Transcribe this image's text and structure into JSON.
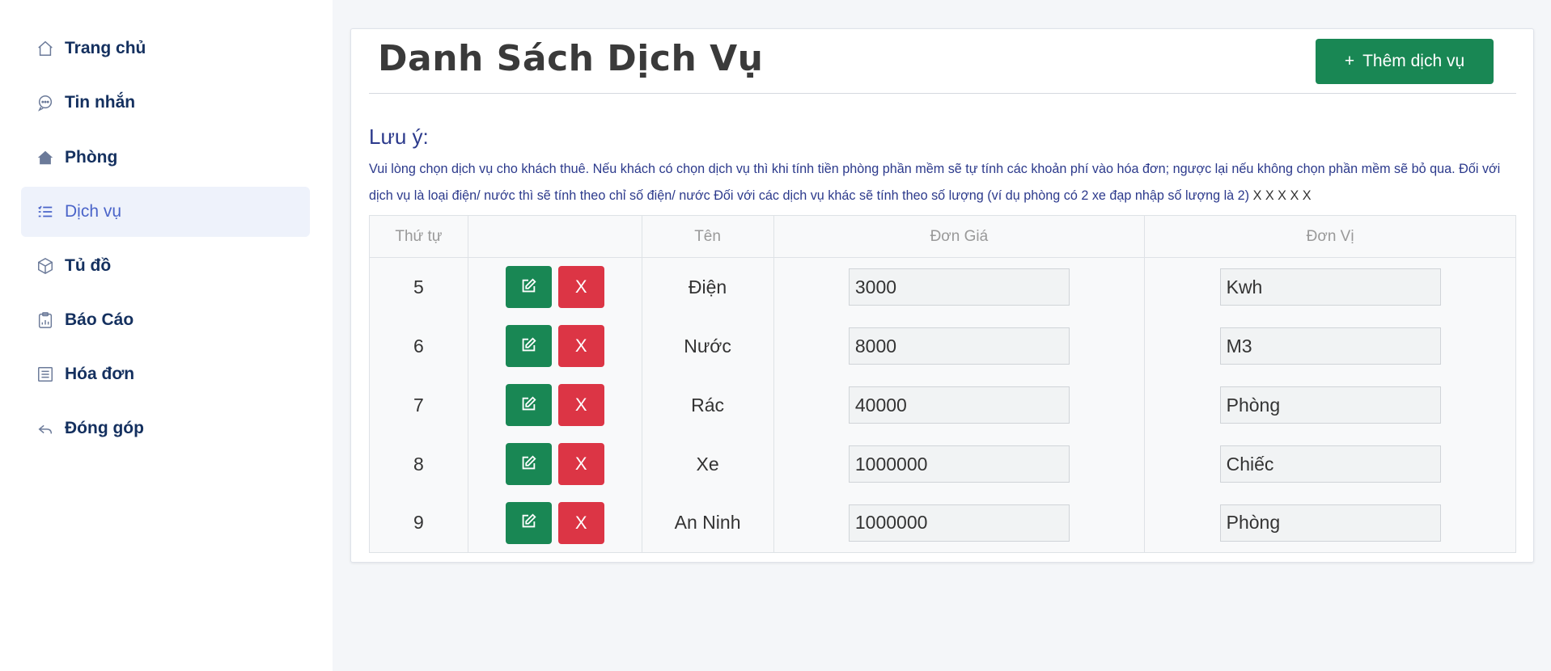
{
  "sidebar": {
    "items": [
      {
        "label": "Trang chủ",
        "icon": "home-icon"
      },
      {
        "label": "Tin nhắn",
        "icon": "chat-icon"
      },
      {
        "label": "Phòng",
        "icon": "house-icon"
      },
      {
        "label": "Dịch vụ",
        "icon": "list-icon",
        "active": true
      },
      {
        "label": "Tủ đồ",
        "icon": "box-icon"
      },
      {
        "label": "Báo Cáo",
        "icon": "clipboard-icon"
      },
      {
        "label": "Hóa đơn",
        "icon": "receipt-icon"
      },
      {
        "label": "Đóng góp",
        "icon": "reply-icon"
      }
    ]
  },
  "main": {
    "title": "Danh Sách Dịch Vụ",
    "add_button": "Thêm dịch vụ",
    "add_button_icon": "+",
    "note_heading": "Lưu ý:",
    "note_text": "Vui lòng chọn dịch vụ cho khách thuê. Nếu khách có chọn dịch vụ thì khi tính tiền phòng phần mềm sẽ tự tính các khoản phí vào hóa đơn; ngược lại nếu không chọn phần mềm sẽ bỏ qua. Đối với dịch vụ là loại điện/ nước thì sẽ tính theo chỉ số điện/ nước Đối với các dịch vụ khác sẽ tính theo số lượng (ví dụ phòng có 2 xe đạp nhập số lượng là 2)",
    "note_suffix": "X X X X X"
  },
  "table": {
    "headers": [
      "Thứ tự",
      "",
      "Tên",
      "Đơn Giá",
      "Đơn Vị"
    ],
    "delete_label": "X",
    "rows": [
      {
        "order": "5",
        "name": "Điện",
        "price": "3000",
        "unit": "Kwh"
      },
      {
        "order": "6",
        "name": "Nước",
        "price": "8000",
        "unit": "M3"
      },
      {
        "order": "7",
        "name": "Rác",
        "price": "40000",
        "unit": "Phòng"
      },
      {
        "order": "8",
        "name": "Xe",
        "price": "1000000",
        "unit": "Chiếc"
      },
      {
        "order": "9",
        "name": "An Ninh",
        "price": "1000000",
        "unit": "Phòng"
      }
    ]
  },
  "colors": {
    "primary_green": "#198754",
    "danger_red": "#dc3545",
    "nav_text": "#14305f",
    "active_accent": "#4a64c9"
  }
}
